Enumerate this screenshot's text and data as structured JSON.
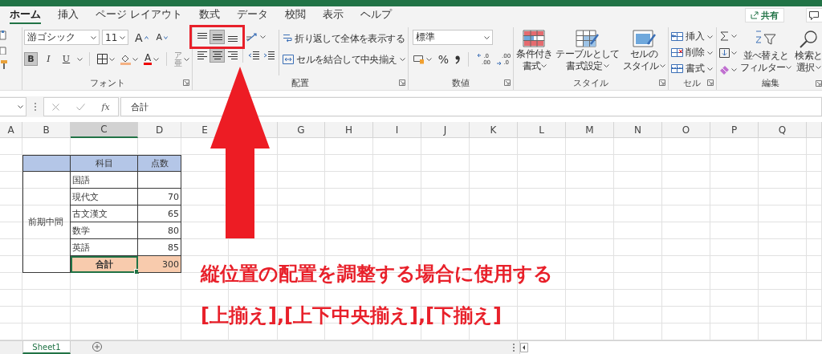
{
  "tabs": [
    {
      "label": "ホーム",
      "selected": true
    },
    {
      "label": "挿入",
      "selected": false
    },
    {
      "label": "ページ レイアウト",
      "selected": false
    },
    {
      "label": "数式",
      "selected": false
    },
    {
      "label": "データ",
      "selected": false
    },
    {
      "label": "校閲",
      "selected": false
    },
    {
      "label": "表示",
      "selected": false
    },
    {
      "label": "ヘルプ",
      "selected": false
    }
  ],
  "share_button": {
    "label": "共有"
  },
  "font_group": {
    "label": "フォント",
    "font_name": "游ゴシック",
    "font_size": "11",
    "grow": "A",
    "shrink": "A",
    "font_color_label": "A",
    "phonetic": [
      "ア",
      "亜"
    ],
    "styles": [
      {
        "label": "B",
        "kind": "bold",
        "selected": true
      },
      {
        "label": "I",
        "kind": "italic",
        "selected": false
      },
      {
        "label": "U",
        "kind": "underline",
        "selected": false
      }
    ]
  },
  "alignment_group": {
    "label": "配置",
    "wrap_text": "折り返して全体を表示する",
    "merge": "セルを結合して中央揃え",
    "vertical": [
      {
        "kind": "top",
        "selected": false
      },
      {
        "kind": "middle",
        "selected": true
      },
      {
        "kind": "bottom",
        "selected": false
      }
    ],
    "horizontal": [
      {
        "kind": "left",
        "selected": false
      },
      {
        "kind": "center",
        "selected": true
      },
      {
        "kind": "right",
        "selected": false
      }
    ]
  },
  "number_group": {
    "label": "数値",
    "format": "標準",
    "percent": "%",
    "decimals": [
      {
        "kind": "increase",
        "top": ".0",
        "bottom": ".00"
      },
      {
        "kind": "decrease",
        "top": ".00",
        "bottom": ".0"
      }
    ]
  },
  "style_group": {
    "label": "スタイル",
    "buttons": [
      {
        "kind": "conditional",
        "lines": [
          "条件付き",
          "書式"
        ]
      },
      {
        "kind": "table",
        "lines": [
          "テーブルとして",
          "書式設定"
        ]
      },
      {
        "kind": "cell",
        "lines": [
          "セルの",
          "スタイル"
        ]
      }
    ]
  },
  "cells_group": {
    "label": "セル",
    "buttons": [
      {
        "kind": "insert",
        "label": "挿入"
      },
      {
        "kind": "delete",
        "label": "削除"
      },
      {
        "kind": "format",
        "label": "書式"
      }
    ]
  },
  "edit_group": {
    "label": "編集",
    "small": [
      {
        "kind": "sum"
      },
      {
        "kind": "fill"
      },
      {
        "kind": "clear"
      }
    ],
    "big": [
      {
        "kind": "sort",
        "lines": [
          "並べ替えと",
          "フィルター"
        ]
      },
      {
        "kind": "find",
        "lines": [
          "検索と",
          "選択"
        ]
      }
    ]
  },
  "formula_bar": {
    "function_label": "fx",
    "value": "合計"
  },
  "columns": [
    {
      "label": "A",
      "selected": false
    },
    {
      "label": "B",
      "selected": false
    },
    {
      "label": "C",
      "selected": true
    },
    {
      "label": "D",
      "selected": false
    },
    {
      "label": "E",
      "selected": false
    },
    {
      "selected": false
    },
    {
      "label": "G",
      "selected": false
    },
    {
      "label": "H",
      "selected": false
    },
    {
      "label": "I",
      "selected": false
    },
    {
      "label": "J",
      "selected": false
    },
    {
      "label": "K",
      "selected": false
    },
    {
      "label": "L",
      "selected": false
    },
    {
      "label": "M",
      "selected": false
    },
    {
      "label": "N",
      "selected": false
    },
    {
      "label": "O",
      "selected": false
    },
    {
      "label": "P",
      "selected": false
    },
    {
      "label": "Q",
      "selected": false
    },
    {
      "selected": false
    }
  ],
  "sheet": {
    "group_label": "前期中間",
    "headers": [
      "科目",
      "点数"
    ],
    "rows": [
      {
        "subject": "国語"
      },
      {
        "subject": "現代文",
        "score": "70"
      },
      {
        "subject": "古文漢文",
        "score": "65"
      },
      {
        "subject": "数学",
        "score": "80"
      },
      {
        "subject": "英語",
        "score": "85"
      }
    ],
    "total": {
      "label": "合計",
      "score": "300",
      "selected": true
    }
  },
  "annotation": {
    "lines": [
      "縦位置の配置を調整する場合に使用する",
      "[上揃え],[上下中央揃え],[下揃え]"
    ]
  },
  "sheet_tabs": [
    {
      "label": "Sheet1",
      "selected": true
    }
  ]
}
